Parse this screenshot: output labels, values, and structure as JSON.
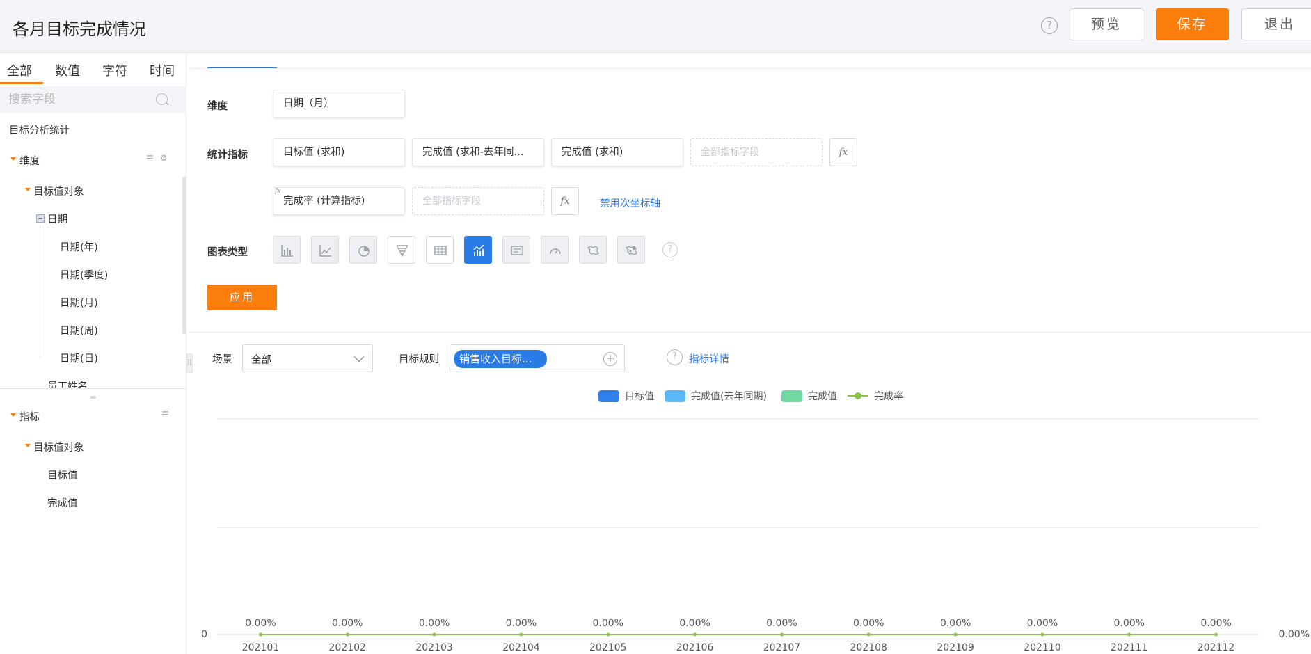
{
  "header": {
    "title": "各月目标完成情况",
    "help_glyph": "?",
    "preview_label": "预览",
    "save_label": "保存",
    "exit_label": "退出"
  },
  "sidebar": {
    "tabs": [
      "全部",
      "数值",
      "字符",
      "时间"
    ],
    "search_placeholder": "搜索字段",
    "dataset_name": "目标分析统计",
    "dimension_group": "维度",
    "dimension_object": "目标值对象",
    "date_node": "日期",
    "date_children": [
      "日期(年)",
      "日期(季度)",
      "日期(月)",
      "日期(周)",
      "日期(日)"
    ],
    "employee_name": "员工姓名",
    "metric_group": "指标",
    "metric_object": "目标值对象",
    "metric_children": [
      "目标值",
      "完成值"
    ]
  },
  "config": {
    "dimension_label": "维度",
    "dimension_chip": "日期（月）",
    "metrics_label": "统计指标",
    "metric_chips": [
      "目标值 (求和)",
      "完成值 (求和-去年同...",
      "完成值 (求和)"
    ],
    "calc_chip": "完成率 (计算指标)",
    "empty_slot": "全部指标字段",
    "fx_label": "fx",
    "secondary_axis_link": "禁用次坐标轴",
    "chart_type_label": "图表类型",
    "chart_types": [
      "bar-chart-icon",
      "line-chart-icon",
      "pie-chart-icon",
      "funnel-chart-icon",
      "table-icon",
      "combo-chart-icon",
      "text-card-icon",
      "gauge-icon",
      "map-icon",
      "bubble-map-icon"
    ],
    "active_chart_type": "combo-chart-icon",
    "help_glyph": "?",
    "apply_label": "应用"
  },
  "filters": {
    "scene_label": "场景",
    "scene_value": "全部",
    "rule_label": "目标规则",
    "rule_tag": "销售收入目标...",
    "add_glyph": "+",
    "help_glyph": "?",
    "detail_link": "指标详情"
  },
  "colors": {
    "accent_orange": "#fb7d0c",
    "accent_blue": "#2b7be6",
    "series_target": "#2f80ed",
    "series_last_year": "#5cb8f7",
    "series_actual": "#6fd9a1",
    "series_rate": "#8bc34a"
  },
  "chart_data": {
    "type": "bar",
    "categories": [
      "202101",
      "202102",
      "202103",
      "202104",
      "202105",
      "202106",
      "202107",
      "202108",
      "202109",
      "202110",
      "202111",
      "202112"
    ],
    "series": [
      {
        "name": "目标值",
        "type": "bar",
        "axis": "left",
        "values": [
          0,
          0,
          0,
          0,
          0,
          0,
          0,
          0,
          0,
          0,
          0,
          0
        ]
      },
      {
        "name": "完成值(去年同期)",
        "type": "bar",
        "axis": "left",
        "values": [
          0,
          0,
          0,
          0,
          0,
          0,
          0,
          0,
          0,
          0,
          0,
          0
        ]
      },
      {
        "name": "完成值",
        "type": "bar",
        "axis": "left",
        "values": [
          0,
          0,
          0,
          0,
          0,
          0,
          0,
          0,
          0,
          0,
          0,
          0
        ]
      },
      {
        "name": "完成率",
        "type": "line",
        "axis": "right",
        "values": [
          0,
          0,
          0,
          0,
          0,
          0,
          0,
          0,
          0,
          0,
          0,
          0
        ]
      }
    ],
    "point_labels": [
      "0.00%",
      "0.00%",
      "0.00%",
      "0.00%",
      "0.00%",
      "0.00%",
      "0.00%",
      "0.00%",
      "0.00%",
      "0.00%",
      "0.00%",
      "0.00%"
    ],
    "y_left_tick_label": "0",
    "y_right_tick_label": "0.00%",
    "grid": true,
    "legend_position": "top-center"
  }
}
